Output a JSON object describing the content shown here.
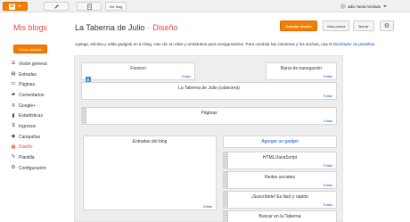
{
  "topbar": {
    "blogger_icon": "blogger-icon",
    "view_blog": "Ver blog",
    "user_name": "Julio Yamá Andrade"
  },
  "header": {
    "my_blogs": "Mis blogs",
    "blog_name": "La Taberna de Julio",
    "separator": "·",
    "section": "Diseño"
  },
  "actions": {
    "save": "Guardar diseño",
    "preview": "Vista previa",
    "discard": "Borrar",
    "settings_icon": "gear-icon"
  },
  "sidebar": {
    "create": "Crear entrada",
    "items": [
      {
        "label": "Visión general",
        "icon": "list-icon",
        "glyph": "☰"
      },
      {
        "label": "Entradas",
        "icon": "posts-icon",
        "glyph": "▤"
      },
      {
        "label": "Páginas",
        "icon": "pages-icon",
        "glyph": "▭"
      },
      {
        "label": "Comentarios",
        "icon": "comment-icon",
        "glyph": "▰"
      },
      {
        "label": "Google+",
        "icon": "google-plus-icon",
        "glyph": "g"
      },
      {
        "label": "Estadísticas",
        "icon": "stats-icon",
        "glyph": "▮"
      },
      {
        "label": "Ingresos",
        "icon": "money-icon",
        "glyph": "$"
      },
      {
        "label": "Campañas",
        "icon": "campaign-icon",
        "glyph": "◆"
      },
      {
        "label": "Diseño",
        "icon": "layout-icon",
        "glyph": "▦",
        "active": true
      },
      {
        "label": "Plantilla",
        "icon": "template-icon",
        "glyph": "✎"
      },
      {
        "label": "Configuración",
        "icon": "wrench-icon",
        "glyph": "⚙"
      }
    ]
  },
  "intro": {
    "text": "Agrega, elimina y edita gadgets en tu blog. Haz clic en ellos y arrástralos para reorganizarlos. Para cambiar las columnas y los anchos, usa el",
    "link": "Diseñador de plantillas",
    "end": "."
  },
  "gadgets": {
    "edit": "Editar",
    "favicon": "Favicon",
    "navbar": "Barra de navegación",
    "header": "La Taberna de Julio (cabecera)",
    "pages": "Páginas",
    "posts": "Entradas del blog",
    "add_gadget": "Agregar un gadget",
    "html": "HTML/JavaScript",
    "social": "Redes sociales",
    "subscribe": "¡Suscríbete! Es fácil y rápido",
    "search": "Buscar en la Taberna"
  }
}
